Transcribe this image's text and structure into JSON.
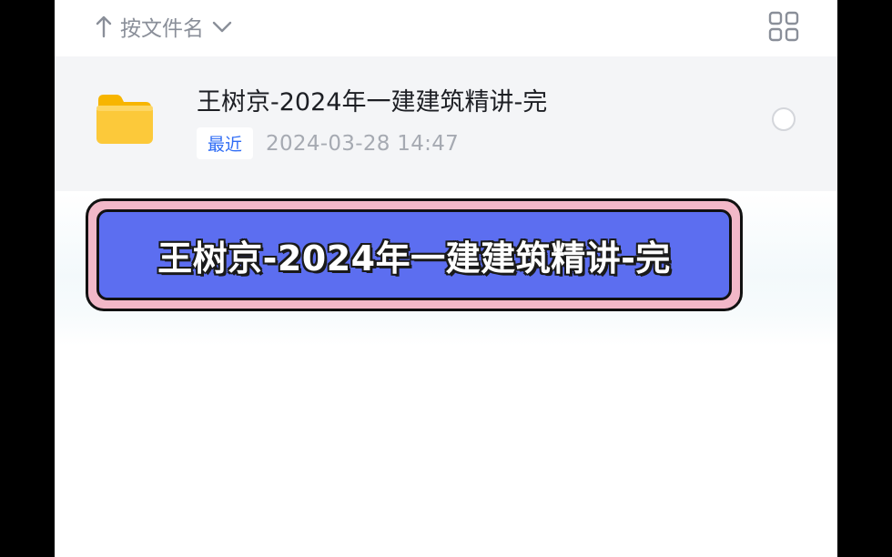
{
  "sort": {
    "label": "按文件名",
    "arrow_icon": "arrow-up-icon",
    "chevron_icon": "chevron-down-icon"
  },
  "view_toggle": {
    "icon": "grid-view-icon"
  },
  "file": {
    "icon": "folder-icon",
    "name": "王树京-2024年一建建筑精讲-完",
    "badge": "最近",
    "date": "2024-03-28  14:47"
  },
  "banner": {
    "text": "王树京-2024年一建建筑精讲-完"
  },
  "colors": {
    "accent": "#2f6cf5",
    "banner_fill": "#5c6ef0",
    "banner_border": "#f2b8c8",
    "folder": "#fbc531",
    "row_bg": "#f4f5f7"
  }
}
